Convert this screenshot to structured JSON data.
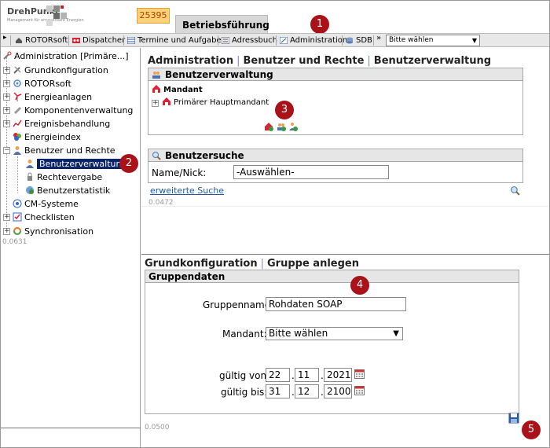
{
  "header": {
    "logo_text": "DrehPunkt",
    "logo_sub": "Management für erneuerbare Energien",
    "code_badge": "25395",
    "tab_label": "Betriebsführung"
  },
  "toolbar": {
    "items": [
      "ROTORsoft",
      "Dispatcher",
      "Termine und Aufgaben",
      "Adressbuch",
      "Administration",
      "SDB"
    ],
    "select_value": "Bitte wählen"
  },
  "sidebar": {
    "root": "Administration [Primäre...]",
    "items": [
      "Grundkonfiguration",
      "ROTORsoft",
      "Energieanlagen",
      "Komponentenverwaltung",
      "Ereignisbehandlung",
      "Energieindex",
      "Benutzer und Rechte"
    ],
    "sub_items": [
      "Benutzerverwaltung",
      "Rechtevergabe",
      "Benutzerstatistik"
    ],
    "items_after": [
      "CM-Systeme",
      "Checklisten",
      "Synchronisation"
    ],
    "timing": "0.0631"
  },
  "main_top": {
    "breadcrumb": [
      "Administration",
      "Benutzer und Rechte",
      "Benutzerverwaltung"
    ],
    "panel1_title": "Benutzerverwaltung",
    "mandant_label": "Mandant",
    "mandant_item": "Primärer Hauptmandant",
    "panel2_title": "Benutzersuche",
    "name_label": "Name/Nick:",
    "name_value": "-Auswählen-",
    "advanced_search": "erweiterte Suche",
    "timing": "0.0472"
  },
  "main_bottom": {
    "breadcrumb": [
      "Grundkonfiguration",
      "Gruppe anlegen"
    ],
    "panel_title": "Gruppendaten",
    "group_name_label": "Gruppenname:",
    "group_name_value": "Rohdaten SOAP",
    "mandant_label": "Mandant:",
    "mandant_value": "Bitte wählen",
    "valid_from_label": "gültig von:",
    "valid_from": [
      "22",
      "11",
      "2021"
    ],
    "valid_to_label": "gültig bis:",
    "valid_to": [
      "31",
      "12",
      "2100"
    ],
    "timing": "0.0500"
  },
  "markers": [
    "1",
    "2",
    "3",
    "4",
    "5"
  ],
  "colors": {
    "accent_marker": "#a81218",
    "selection": "#0a246a",
    "link": "#1f5aa6",
    "badge": "#ffd27a"
  }
}
